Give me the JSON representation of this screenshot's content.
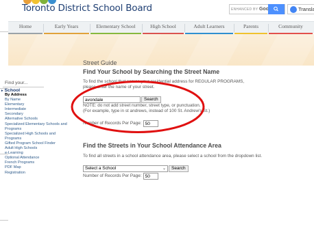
{
  "header": {
    "brand": "Toronto District School Board",
    "search_label_small": "ENHANCED BY",
    "search_label_brand": "Google",
    "translate_label": "Translate",
    "logo_colors": [
      "#e9a03b",
      "#f2c230",
      "#7fb23a",
      "#3a8fd0"
    ]
  },
  "nav": {
    "items": [
      {
        "label": "Home",
        "bar": "#9aa2a8"
      },
      {
        "label": "Early Years",
        "bar": "#e0a13a"
      },
      {
        "label": "Elementary School",
        "bar": "#86b83e"
      },
      {
        "label": "High School",
        "bar": "#d9534f"
      },
      {
        "label": "Adult Learners",
        "bar": "#2e8fd0"
      },
      {
        "label": "Parents",
        "bar": "#f0c22e"
      },
      {
        "label": "Community",
        "bar": "#e2504c"
      }
    ]
  },
  "sidebar": {
    "heading": "Find your...",
    "category": "School",
    "items": [
      "By Address",
      "By Name",
      "Elementary",
      "Intermediate",
      "Secondary",
      "Alternative Schools",
      "Specialized Elementary Schools and Programs",
      "Specialized High Schools and Programs",
      "Gifted Program School Finder",
      "Adult High Schools",
      "e-Learning",
      "Optional Attendance",
      "French Programs",
      "PDF Map",
      "Registration"
    ],
    "active_index": 0
  },
  "main": {
    "guide_title": "Street Guide",
    "heading1": "Find Your School by Searching the Street Name",
    "intro_line1": "To find the school that serves your residential address for REGULAR PROGRAMS,",
    "intro_line2": "please enter the name of your street.",
    "street_value": "avondale",
    "search_button": "Search",
    "note_line1": "NOTE: do not add street number, street type, or punctuation.",
    "note_line2": "(For example, type in st andrews, instead of 100 St. Andrew's St.)",
    "records_label": "Number of Records Per Page:",
    "records_value": "50",
    "heading2": "Find the Streets in Your School Attendance Area",
    "area_text": "To find all streets in a school attendance area, please select a school from the dropdown list.",
    "select_value": "Select a School",
    "search_button2": "Search",
    "records_label2": "Number of Records Per Page:",
    "records_value2": "50"
  },
  "annotation_color": "#e01010"
}
